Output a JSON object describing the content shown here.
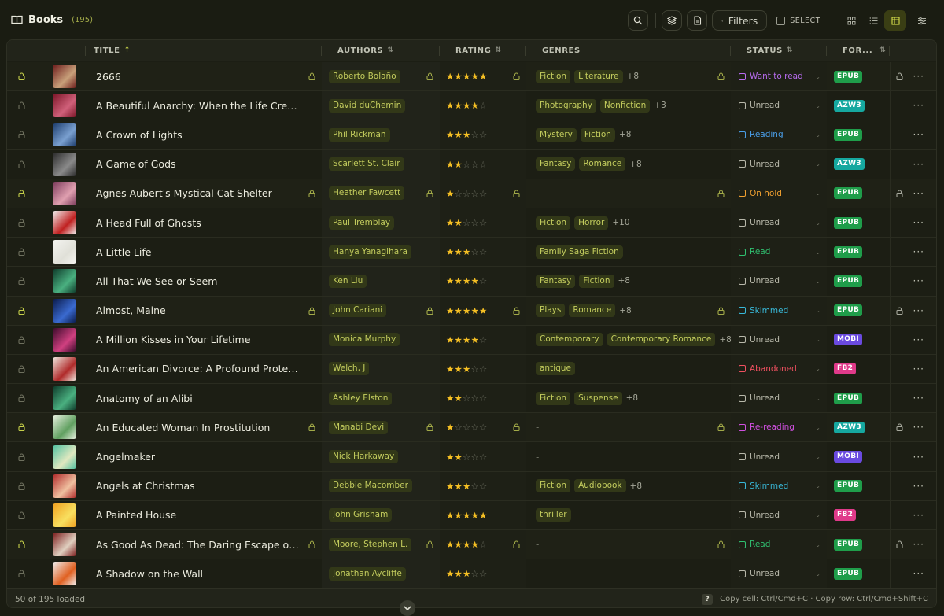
{
  "header": {
    "title": "Books",
    "count": "(195)",
    "filters_label": "Filters",
    "select_label": "SELECT"
  },
  "columns": {
    "title": "TITLE",
    "authors": "AUTHORS",
    "rating": "RATING",
    "genres": "GENRES",
    "status": "STATUS",
    "format": "FOR..."
  },
  "colors": {
    "accent": "#c6d04a",
    "star": "#f6c024",
    "background": "#1a1c12"
  },
  "rows": [
    {
      "title": "2666",
      "author": "Roberto Bolaño",
      "rating": 5,
      "genres": [
        "Fiction",
        "Literature"
      ],
      "more": "+8",
      "status": "Want to read",
      "status_color": "#b86cf0",
      "status_icon": "bookmark-icon",
      "format": "EPUB",
      "format_color": "#1f9d4a",
      "locked": true,
      "cover": [
        "#6b1a1a",
        "#c8a07a"
      ]
    },
    {
      "title": "A Beautiful Anarchy: When the Life Creative ...",
      "author": "David duChemin",
      "rating": 4,
      "genres": [
        "Photography",
        "Nonfiction"
      ],
      "more": "+3",
      "status": "Unread",
      "status_color": "#b8b8aa",
      "status_icon": "book-icon",
      "format": "AZW3",
      "format_color": "#16a8a0",
      "locked": false,
      "cover": [
        "#7a1426",
        "#d0607a"
      ]
    },
    {
      "title": "A Crown of Lights",
      "author": "Phil Rickman",
      "rating": 3,
      "genres": [
        "Mystery",
        "Fiction"
      ],
      "more": "+8",
      "status": "Reading",
      "status_color": "#4a9ee8",
      "status_icon": "open-book-icon",
      "format": "EPUB",
      "format_color": "#1f9d4a",
      "locked": false,
      "cover": [
        "#1a3a6a",
        "#7aa0d0"
      ]
    },
    {
      "title": "A Game of Gods",
      "author": "Scarlett St. Clair",
      "rating": 2,
      "genres": [
        "Fantasy",
        "Romance"
      ],
      "more": "+8",
      "status": "Unread",
      "status_color": "#b8b8aa",
      "status_icon": "book-icon",
      "format": "AZW3",
      "format_color": "#16a8a0",
      "locked": false,
      "cover": [
        "#2a2a2a",
        "#8a8a8a"
      ]
    },
    {
      "title": "Agnes Aubert's Mystical Cat Shelter",
      "author": "Heather Fawcett",
      "rating": 1,
      "genres": [],
      "more": "",
      "status": "On hold",
      "status_color": "#f0a030",
      "status_icon": "pause-icon",
      "format": "EPUB",
      "format_color": "#1f9d4a",
      "locked": true,
      "cover": [
        "#7a3a5a",
        "#e0a0b0"
      ]
    },
    {
      "title": "A Head Full of Ghosts",
      "author": "Paul Tremblay",
      "rating": 2,
      "genres": [
        "Fiction",
        "Horror"
      ],
      "more": "+10",
      "status": "Unread",
      "status_color": "#b8b8aa",
      "status_icon": "book-icon",
      "format": "EPUB",
      "format_color": "#1f9d4a",
      "locked": false,
      "cover": [
        "#f0f0f0",
        "#c02020"
      ]
    },
    {
      "title": "A Little Life",
      "author": "Hanya Yanagihara",
      "rating": 3,
      "genres": [
        "Family Saga Fiction"
      ],
      "more": "",
      "status": "Read",
      "status_color": "#30c070",
      "status_icon": "check-book-icon",
      "format": "EPUB",
      "format_color": "#1f9d4a",
      "locked": false,
      "cover": [
        "#f4f4f0",
        "#e0e0d8"
      ]
    },
    {
      "title": "All That We See or Seem",
      "author": "Ken Liu",
      "rating": 4,
      "genres": [
        "Fantasy",
        "Fiction"
      ],
      "more": "+8",
      "status": "Unread",
      "status_color": "#b8b8aa",
      "status_icon": "book-icon",
      "format": "EPUB",
      "format_color": "#1f9d4a",
      "locked": false,
      "cover": [
        "#0e3a2a",
        "#4ab080"
      ]
    },
    {
      "title": "Almost, Maine",
      "author": "John Cariani",
      "rating": 5,
      "genres": [
        "Plays",
        "Romance"
      ],
      "more": "+8",
      "status": "Skimmed",
      "status_color": "#38b8d8",
      "status_icon": "skim-icon",
      "format": "EPUB",
      "format_color": "#1f9d4a",
      "locked": true,
      "cover": [
        "#0a1a4a",
        "#3a6ad0"
      ]
    },
    {
      "title": "A Million Kisses in Your Lifetime",
      "author": "Monica Murphy",
      "rating": 4,
      "genres": [
        "Contemporary",
        "Contemporary Romance"
      ],
      "more": "+8",
      "status": "Unread",
      "status_color": "#b8b8aa",
      "status_icon": "book-icon",
      "format": "MOBI",
      "format_color": "#6a4ae0",
      "locked": false,
      "cover": [
        "#3a0a2a",
        "#d04080"
      ]
    },
    {
      "title": "An American Divorce: A Profound Protest Ag...",
      "author": "Welch, J",
      "rating": 3,
      "genres": [
        "antique"
      ],
      "more": "",
      "status": "Abandoned",
      "status_color": "#f05060",
      "status_icon": "x-book-icon",
      "format": "FB2",
      "format_color": "#e03a8a",
      "locked": false,
      "cover": [
        "#f0e8e0",
        "#b02a2a"
      ]
    },
    {
      "title": "Anatomy of an Alibi",
      "author": "Ashley Elston",
      "rating": 2,
      "genres": [
        "Fiction",
        "Suspense"
      ],
      "more": "+8",
      "status": "Unread",
      "status_color": "#b8b8aa",
      "status_icon": "book-icon",
      "format": "EPUB",
      "format_color": "#1f9d4a",
      "locked": false,
      "cover": [
        "#0e3a2a",
        "#4ab080"
      ]
    },
    {
      "title": "An Educated Woman In Prostitution",
      "author": "Manabi Devi",
      "rating": 1,
      "genres": [],
      "more": "",
      "status": "Re-reading",
      "status_color": "#d050e0",
      "status_icon": "reread-icon",
      "format": "AZW3",
      "format_color": "#16a8a0",
      "locked": true,
      "cover": [
        "#e8f0e0",
        "#60a060"
      ]
    },
    {
      "title": "Angelmaker",
      "author": "Nick Harkaway",
      "rating": 2,
      "genres": [],
      "more": "",
      "status": "Unread",
      "status_color": "#b8b8aa",
      "status_icon": "book-icon",
      "format": "MOBI",
      "format_color": "#6a4ae0",
      "locked": false,
      "cover": [
        "#50c0a0",
        "#e0e8c0"
      ]
    },
    {
      "title": "Angels at Christmas",
      "author": "Debbie Macomber",
      "rating": 3,
      "genres": [
        "Fiction",
        "Audiobook"
      ],
      "more": "+8",
      "status": "Skimmed",
      "status_color": "#38b8d8",
      "status_icon": "skim-icon",
      "format": "EPUB",
      "format_color": "#1f9d4a",
      "locked": false,
      "cover": [
        "#b02a2a",
        "#f0c0a0"
      ]
    },
    {
      "title": "A Painted House",
      "author": "John Grisham",
      "rating": 5,
      "genres": [
        "thriller"
      ],
      "more": "",
      "status": "Unread",
      "status_color": "#b8b8aa",
      "status_icon": "book-icon",
      "format": "FB2",
      "format_color": "#e03a8a",
      "locked": false,
      "cover": [
        "#f0a020",
        "#f8e060"
      ]
    },
    {
      "title": "As Good As Dead: The Daring Escape of Am...",
      "author": "Moore, Stephen L.",
      "rating": 4,
      "genres": [],
      "more": "",
      "status": "Read",
      "status_color": "#30c070",
      "status_icon": "check-book-icon",
      "format": "EPUB",
      "format_color": "#1f9d4a",
      "locked": true,
      "cover": [
        "#7a1a1a",
        "#e0d0c0"
      ]
    },
    {
      "title": "A Shadow on the Wall",
      "author": "Jonathan Aycliffe",
      "rating": 3,
      "genres": [],
      "more": "",
      "status": "Unread",
      "status_color": "#b8b8aa",
      "status_icon": "book-icon",
      "format": "EPUB",
      "format_color": "#1f9d4a",
      "locked": false,
      "cover": [
        "#f0f0f0",
        "#e06020"
      ]
    }
  ],
  "footer": {
    "loaded": "50 of 195 loaded",
    "shortcuts": "Copy cell: Ctrl/Cmd+C · Copy row: Ctrl/Cmd+Shift+C",
    "help": "?"
  }
}
